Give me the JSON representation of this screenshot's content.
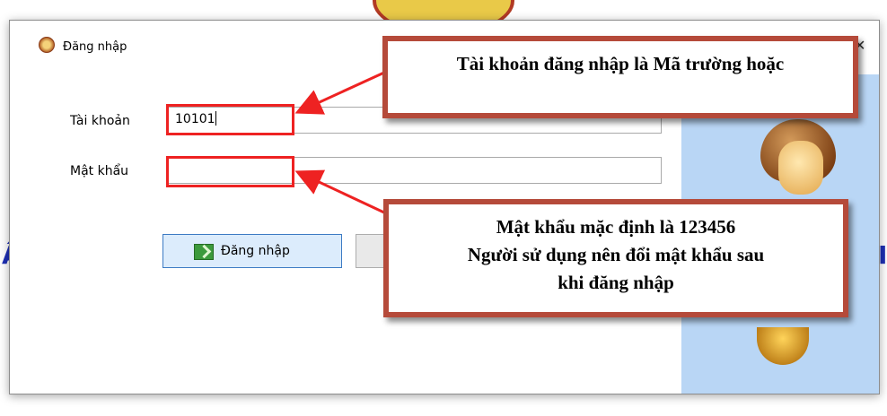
{
  "dialog": {
    "title": "Đăng nhập",
    "app_icon": "app-logo-icon",
    "close_icon": "close-icon",
    "avatar_icon": "user-avatar-icon"
  },
  "form": {
    "account_label": "Tài khoản",
    "account_value": "10101",
    "password_label": "Mật khẩu",
    "password_value": ""
  },
  "buttons": {
    "login_label": "Đăng nhập",
    "login_icon": "login-icon"
  },
  "callouts": {
    "account_note": "Tài khoản đăng nhập là Mã trường hoặc",
    "password_note_lines": [
      "Mật khẩu mặc định là 123456",
      "Người sử dụng nên đổi mật khẩu sau",
      "khi đăng nhập"
    ]
  },
  "background": {
    "left_letter": "Â",
    "right_letter": "I"
  },
  "colors": {
    "highlight": "#ee2222",
    "callout_border": "#b54a3a",
    "side_panel": "#b9d6f5"
  }
}
